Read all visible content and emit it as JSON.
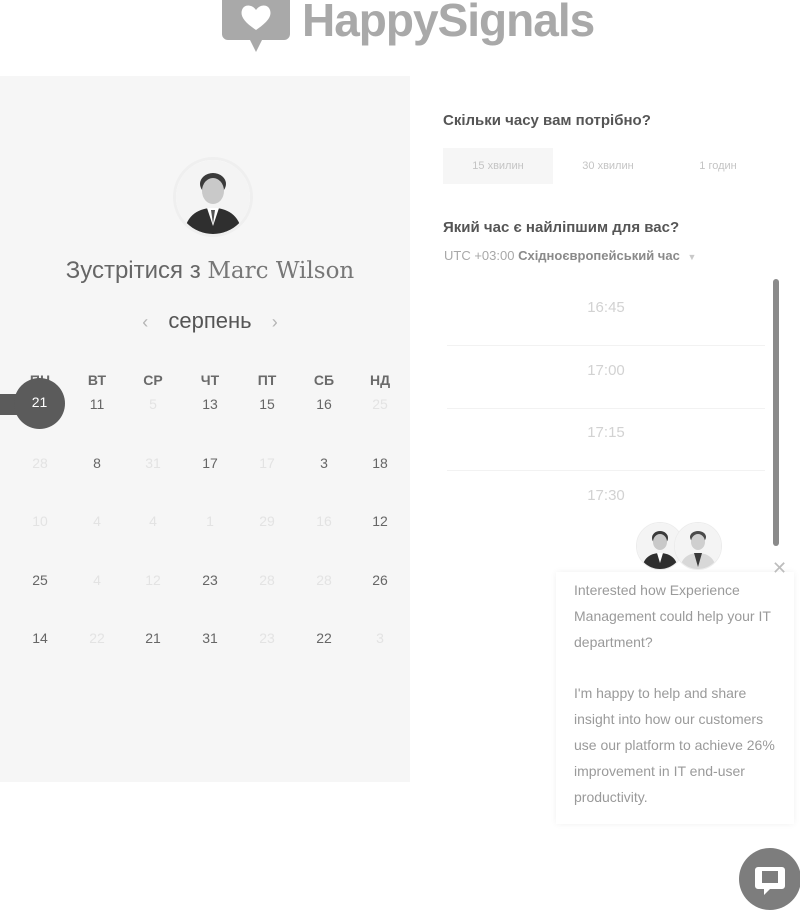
{
  "brand": {
    "name": "HappySignals"
  },
  "host": {
    "title_prefix": "Зустрітися з",
    "name": "Marc Wilson"
  },
  "calendar": {
    "month": "серпень",
    "prev_icon": "chevron-left-icon",
    "next_icon": "chevron-right-icon",
    "weekdays": [
      "ПН",
      "ВТ",
      "СР",
      "ЧТ",
      "ПТ",
      "СБ",
      "НД"
    ],
    "selected_day": "21",
    "rows": [
      [
        {
          "n": "21",
          "avail": true
        },
        {
          "n": "11",
          "avail": true
        },
        {
          "n": "5",
          "avail": false
        },
        {
          "n": "13",
          "avail": true
        },
        {
          "n": "15",
          "avail": true
        },
        {
          "n": "16",
          "avail": true
        },
        {
          "n": "25",
          "avail": false
        }
      ],
      [
        {
          "n": "28",
          "avail": false
        },
        {
          "n": "8",
          "avail": true
        },
        {
          "n": "31",
          "avail": false
        },
        {
          "n": "17",
          "avail": true
        },
        {
          "n": "17",
          "avail": false
        },
        {
          "n": "3",
          "avail": true
        },
        {
          "n": "18",
          "avail": true
        }
      ],
      [
        {
          "n": "10",
          "avail": false
        },
        {
          "n": "4",
          "avail": false
        },
        {
          "n": "4",
          "avail": false
        },
        {
          "n": "1",
          "avail": false
        },
        {
          "n": "29",
          "avail": false
        },
        {
          "n": "16",
          "avail": false
        },
        {
          "n": "12",
          "avail": true
        }
      ],
      [
        {
          "n": "25",
          "avail": true
        },
        {
          "n": "4",
          "avail": false
        },
        {
          "n": "12",
          "avail": false
        },
        {
          "n": "23",
          "avail": true
        },
        {
          "n": "28",
          "avail": false
        },
        {
          "n": "28",
          "avail": false
        },
        {
          "n": "26",
          "avail": true
        }
      ],
      [
        {
          "n": "14",
          "avail": true
        },
        {
          "n": "22",
          "avail": false
        },
        {
          "n": "21",
          "avail": true
        },
        {
          "n": "31",
          "avail": true
        },
        {
          "n": "23",
          "avail": false
        },
        {
          "n": "22",
          "avail": true
        },
        {
          "n": "3",
          "avail": false
        }
      ]
    ]
  },
  "duration": {
    "question": "Скільки часу вам потрібно?",
    "options": [
      "15 хвилин",
      "30 хвилин",
      "1 годин"
    ],
    "active": "15 хвилин"
  },
  "time": {
    "question": "Який час є найліпшим для вас?",
    "tz_offset": "UTC +03:00",
    "tz_name": "Східноєвропейський час",
    "slots": [
      "16:45",
      "17:00",
      "17:15",
      "17:30"
    ]
  },
  "chat": {
    "message_1": "Interested how Experience Management could help your IT department?",
    "message_2": "I'm happy to help and share insight into how our customers use our platform to achieve 26% improvement in IT end-user productivity.",
    "close_icon": "close-icon",
    "launcher_icon": "chat-bubble-icon"
  }
}
